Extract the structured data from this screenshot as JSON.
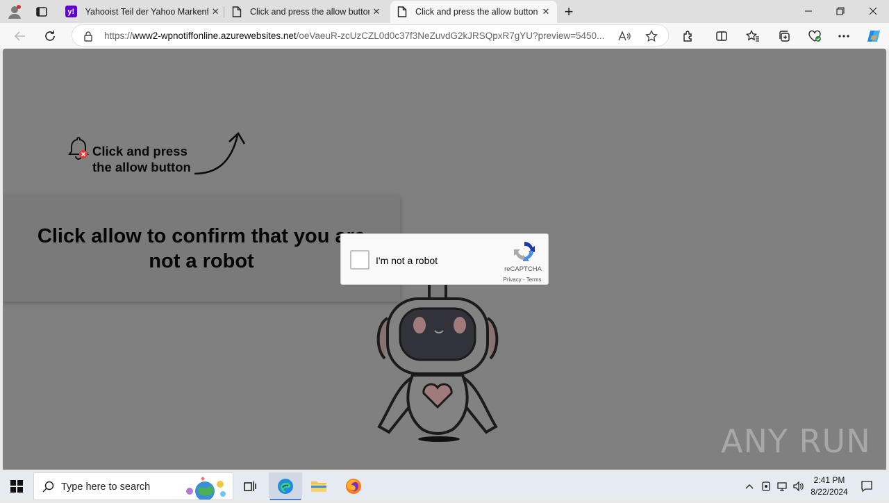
{
  "browser": {
    "tabs": [
      {
        "title": "Yahooist Teil der Yahoo Markenfa",
        "active": false
      },
      {
        "title": "Click and press the allow button",
        "active": false
      },
      {
        "title": "Click and press the allow button",
        "active": true
      }
    ],
    "new_tab_symbol": "+",
    "close_symbol": "✕",
    "address": {
      "prefix": "https://",
      "host": "www2-wpnotiffonline.azurewebsites.net",
      "path": "/oeVaeuR-zcUzCZL0d0c37f3NeZuvdG2kJRSQpxR7gYU?preview=5450..."
    },
    "colors": {
      "accent": "#0f6cbd",
      "yahoo": "#6001d2"
    }
  },
  "page": {
    "hint_line1": "Click and press",
    "hint_line2": "the allow button",
    "confirm_line1": "Click allow to confirm that you are",
    "confirm_line2": "not a robot",
    "captcha": {
      "label": "I'm not a robot",
      "brand": "reCAPTCHA",
      "links": "Privacy - Terms"
    },
    "watermark": "ANY RUN"
  },
  "taskbar": {
    "search_placeholder": "Type here to search",
    "time": "2:41 PM",
    "date": "8/22/2024"
  }
}
